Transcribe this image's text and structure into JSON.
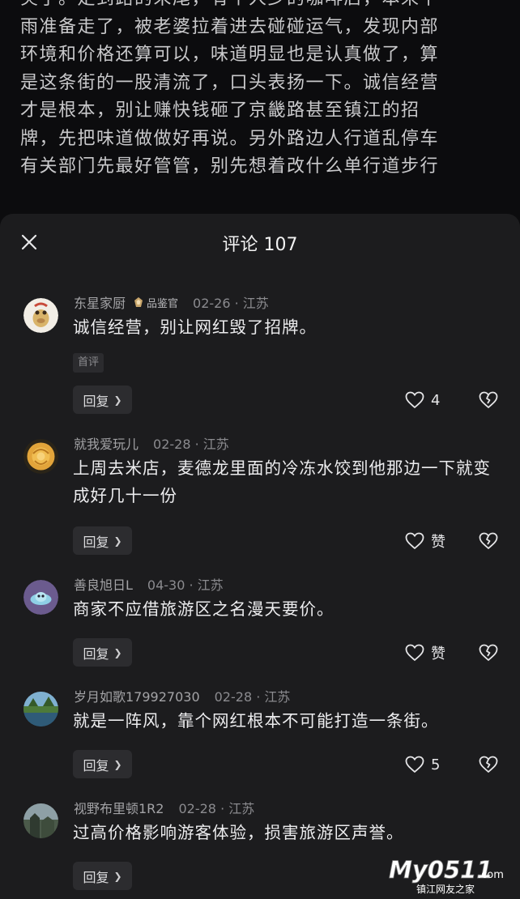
{
  "article": {
    "lines": [
      "突了。走到路的末尾，有个人少的咖啡店，本来下",
      "雨准备走了，被老婆拉着进去碰碰运气，发现内部",
      "环境和价格还算可以，味道明显也是认真做了，算",
      "是这条街的一股清流了，口头表扬一下。诚信经营",
      "才是根本，别让赚快钱砸了京畿路甚至镇江的招",
      "牌，先把味道做做好再说。另外路边人行道乱停车",
      "有关部门先最好管管，别先想着改什么单行道步行"
    ]
  },
  "sheet": {
    "title": "评论 107"
  },
  "comments": [
    {
      "name": "东星家厨",
      "badge": "品鉴官",
      "date": "02-26 · 江苏",
      "text": "诚信经营，别让网红毁了招牌。",
      "tag": "首评",
      "reply_label": "回复",
      "likes": "4"
    },
    {
      "name": "就我爱玩儿",
      "date": "02-28 · 江苏",
      "text": "上周去米店，麦德龙里面的冷冻水饺到他那边一下就变成好几十一份",
      "reply_label": "回复",
      "likes": "赞"
    },
    {
      "name": "善良旭日L",
      "date": "04-30 · 江苏",
      "text": "商家不应借旅游区之名漫天要价。",
      "reply_label": "回复",
      "likes": "赞"
    },
    {
      "name": "岁月如歌179927030",
      "date": "02-28 · 江苏",
      "text": "就是一阵风，靠个网红根本不可能打造一条街。",
      "reply_label": "回复",
      "likes": "5"
    },
    {
      "name": "视野布里顿1R2",
      "date": "02-28 · 江苏",
      "text": "过高价格影响游客体验，损害旅游区声誉。",
      "reply_label": "回复",
      "likes": ""
    }
  ],
  "watermark": {
    "brand": "My0511",
    "suffix": ".com",
    "tagline": "镇江网友之家"
  },
  "colors": {
    "background": "#0d0d0f",
    "sheet": "#1c1c1e",
    "reply_button": "#2c2c2f"
  }
}
